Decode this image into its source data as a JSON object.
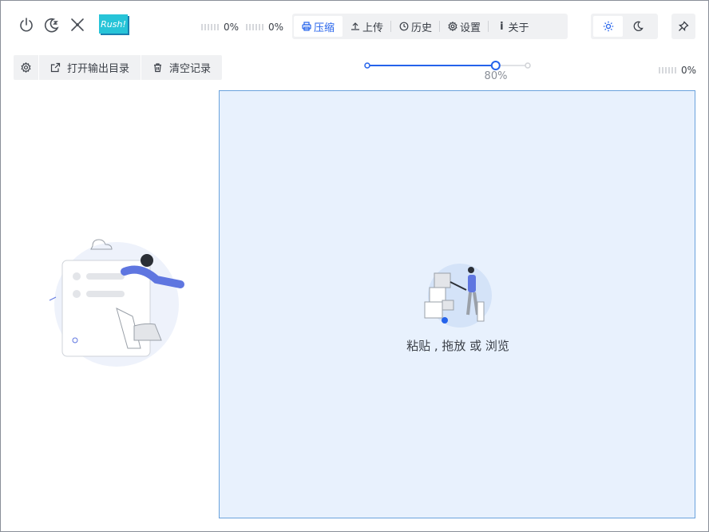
{
  "header": {
    "logo_text": "Rush!",
    "meter_1": "0%",
    "meter_2": "0%",
    "nav": {
      "compress": "压缩",
      "upload": "上传",
      "history": "历史",
      "settings": "设置",
      "about": "关于"
    },
    "active_tab": "compress"
  },
  "toolbar": {
    "open_output_dir": "打开输出目录",
    "clear_records": "清空记录"
  },
  "quality_slider": {
    "value": 80,
    "label": "80%"
  },
  "meter_3": "0%",
  "dropzone": {
    "text": "粘贴 , 拖放 或 浏览"
  },
  "colors": {
    "accent": "#2563eb",
    "dropzone_bg": "#e8f1fd",
    "dropzone_border": "#6aa2dc",
    "logo": "#27c4d8"
  },
  "icons": [
    "power-icon",
    "sleep-icon",
    "shrink-icon",
    "printer-icon",
    "upload-icon",
    "history-icon",
    "gear-icon",
    "info-icon",
    "sun-icon",
    "moon-icon",
    "pin-icon",
    "external-link-icon",
    "trash-icon"
  ]
}
